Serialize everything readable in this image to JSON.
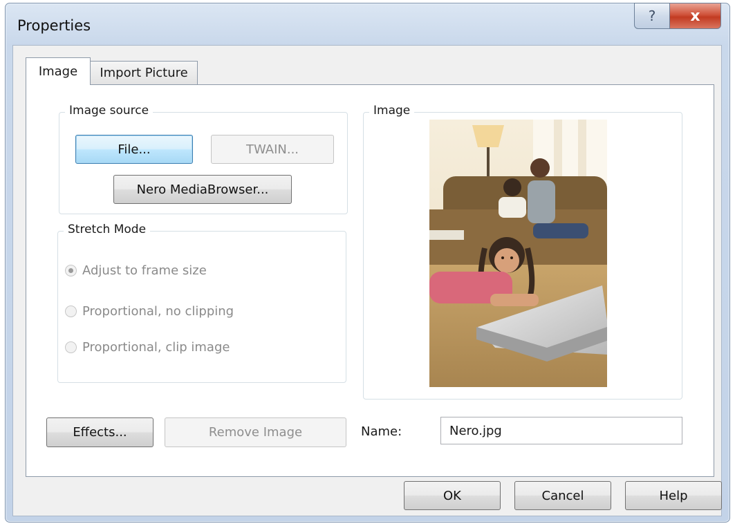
{
  "window": {
    "title": "Properties",
    "help_glyph": "?",
    "close_glyph": "x"
  },
  "tabs": [
    {
      "label": "Image",
      "active": true
    },
    {
      "label": "Import Picture",
      "active": false
    }
  ],
  "image_source": {
    "legend": "Image source",
    "file_button": "File...",
    "twain_button": "TWAIN...",
    "mediabrowser_button": "Nero MediaBrowser..."
  },
  "stretch_mode": {
    "legend": "Stretch Mode",
    "options": [
      {
        "label": "Adjust to frame size",
        "selected": true
      },
      {
        "label": "Proportional, no clipping",
        "selected": false
      },
      {
        "label": "Proportional, clip image",
        "selected": false
      }
    ]
  },
  "image_preview": {
    "legend": "Image"
  },
  "actions": {
    "effects_button": "Effects...",
    "remove_button": "Remove Image"
  },
  "name_field": {
    "label": "Name:",
    "value": "Nero.jpg"
  },
  "footer": {
    "ok": "OK",
    "cancel": "Cancel",
    "help": "Help"
  },
  "colors": {
    "default_button_border": "#3c7fb1",
    "close_button": "#c23b22",
    "window_frame": "#c3d3e8"
  }
}
